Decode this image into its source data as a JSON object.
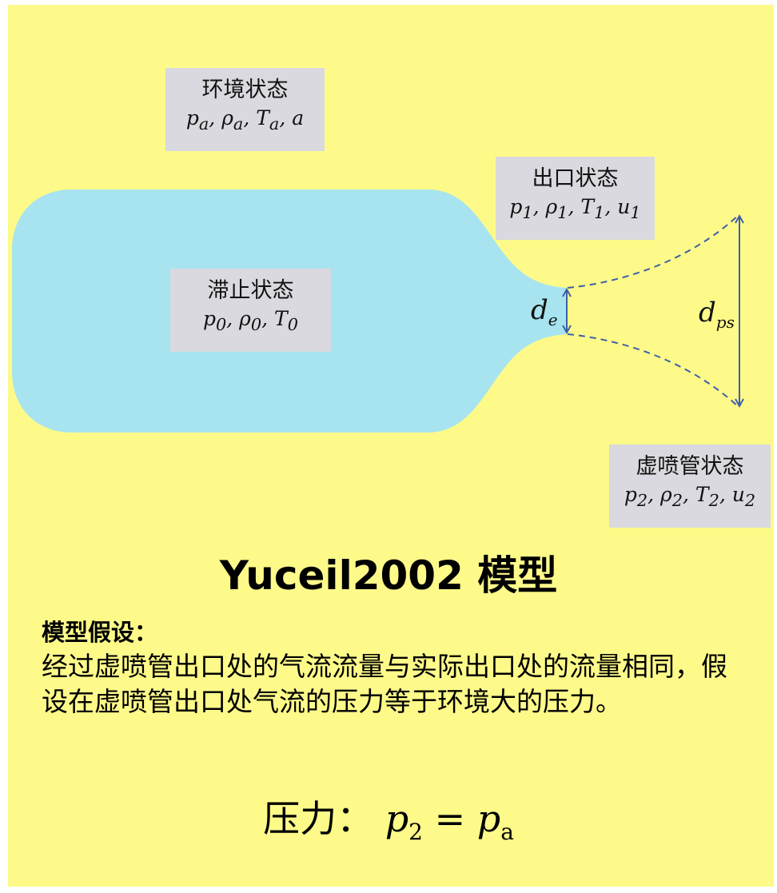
{
  "boxes": {
    "ambient": {
      "title": "环境状态",
      "vars": "pa, ρa, Ta, a"
    },
    "exit": {
      "title": "出口状态",
      "vars": "p1, ρ1, T1, u1"
    },
    "stagnation": {
      "title": "滞止状态",
      "vars": "p0, ρ0, T0"
    },
    "pseudo": {
      "title": "虚喷管状态",
      "vars": "p2, ρ2, T2, u2"
    }
  },
  "labels": {
    "de": "de",
    "dps": "dps"
  },
  "model_title": "Yuceil2002 模型",
  "assumption": {
    "title": "模型假设：",
    "text": "经过虚喷管出口处的气流流量与实际出口处的流量相同，假设在虚喷管出口处气流的压力等于环境大的压力。"
  },
  "formula": {
    "label": "压力：",
    "expression": "p2 = pa"
  },
  "colors": {
    "background": "#fdfa8a",
    "vessel": "#a8e4ef",
    "box": "#d9d9df",
    "line": "#3d5fa8"
  }
}
